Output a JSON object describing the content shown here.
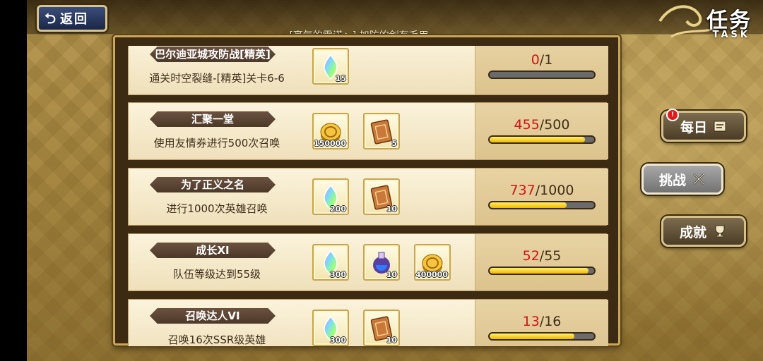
{
  "header": {
    "back_label": "返回",
    "back_arrow": "⮌",
    "banner": "[豪气的雷诺丶] 加防的剑有毛用",
    "title": "任务",
    "title_en": "TASK"
  },
  "side_tabs": {
    "daily": {
      "label": "每日",
      "badge": "!"
    },
    "challenge": {
      "label": "挑战"
    },
    "achievement": {
      "label": "成就"
    }
  },
  "tasks": [
    {
      "title": "巴尔迪亚城攻防战[精英]",
      "desc": "通关时空裂缝-[精英]关卡6-6",
      "rewards": [
        {
          "icon": "rainbow-crystal-icon",
          "count": "15"
        }
      ],
      "current": "0",
      "total": "1",
      "progress": 0
    },
    {
      "title": "汇聚一堂",
      "desc": "使用友情券进行500次召唤",
      "rewards": [
        {
          "icon": "gold-coin-icon",
          "count": "150000"
        },
        {
          "icon": "summon-ticket-icon",
          "count": "5"
        }
      ],
      "current": "455",
      "total": "500",
      "progress": 0.91
    },
    {
      "title": "为了正义之名",
      "desc": "进行1000次英雄召唤",
      "rewards": [
        {
          "icon": "rainbow-crystal-icon",
          "count": "200"
        },
        {
          "icon": "summon-ticket-icon",
          "count": "10"
        }
      ],
      "current": "737",
      "total": "1000",
      "progress": 0.737
    },
    {
      "title": "成长XI",
      "desc": "队伍等级达到55级",
      "rewards": [
        {
          "icon": "rainbow-crystal-icon",
          "count": "300"
        },
        {
          "icon": "blue-potion-icon",
          "count": "10"
        },
        {
          "icon": "gold-coin-icon",
          "count": "400000"
        }
      ],
      "current": "52",
      "total": "55",
      "progress": 0.945
    },
    {
      "title": "召唤达人VI",
      "desc": "召唤16次SSR级英雄",
      "rewards": [
        {
          "icon": "rainbow-crystal-icon",
          "count": "300"
        },
        {
          "icon": "summon-ticket-icon",
          "count": "10"
        }
      ],
      "current": "13",
      "total": "16",
      "progress": 0.8125
    }
  ]
}
